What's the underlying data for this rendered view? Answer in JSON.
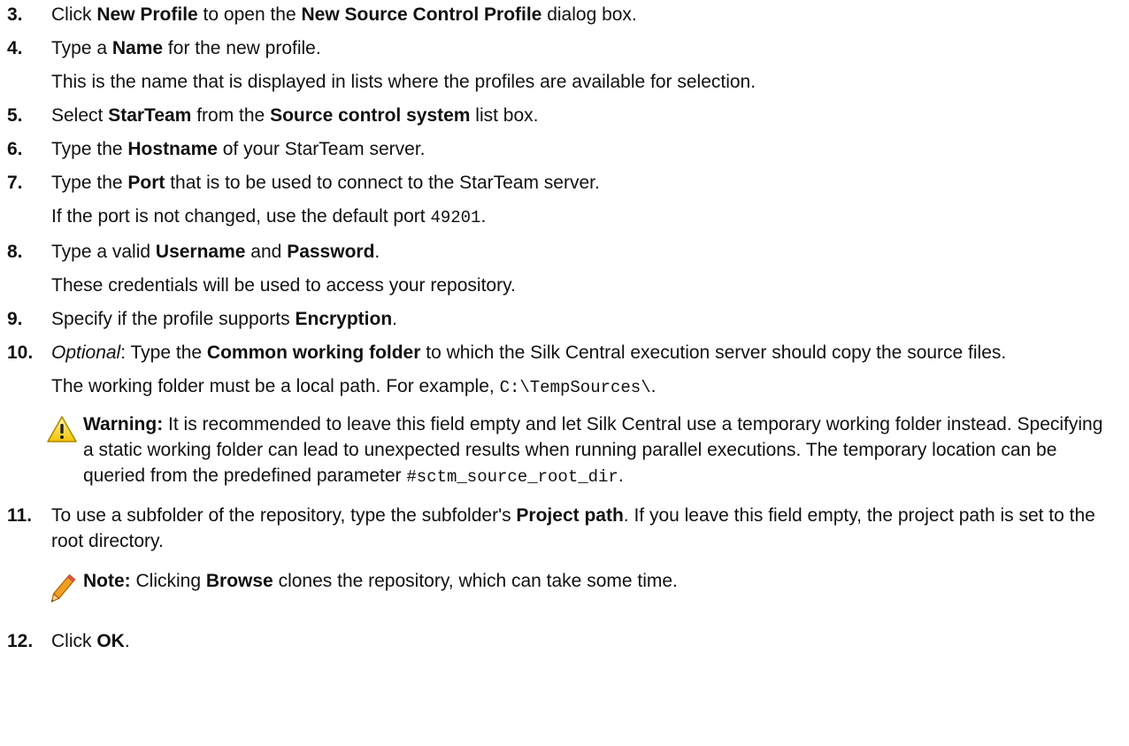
{
  "steps": [
    {
      "num": "3.",
      "parts": [
        "Click ",
        "New Profile",
        " to open the ",
        "New Source Control Profile",
        " dialog box."
      ]
    },
    {
      "num": "4.",
      "parts": [
        "Type a ",
        "Name",
        " for the new profile."
      ],
      "note": "This is the name that is displayed in lists where the profiles are available for selection."
    },
    {
      "num": "5.",
      "parts": [
        "Select ",
        "StarTeam",
        " from the ",
        "Source control system",
        " list box."
      ]
    },
    {
      "num": "6.",
      "parts": [
        "Type the ",
        "Hostname",
        " of your StarTeam server."
      ]
    },
    {
      "num": "7.",
      "parts": [
        "Type the ",
        "Port",
        " that is to be used to connect to the StarTeam server."
      ],
      "note_parts": [
        "If the port is not changed, use the default port ",
        "49201",
        "."
      ]
    },
    {
      "num": "8.",
      "parts": [
        "Type a valid ",
        "Username",
        " and ",
        "Password",
        "."
      ],
      "note": "These credentials will be used to access your repository."
    },
    {
      "num": "9.",
      "parts": [
        "Specify if the profile supports ",
        "Encryption",
        "."
      ]
    },
    {
      "num": "10.",
      "parts": [
        "Optional",
        ": Type the ",
        "Common working folder",
        " to which the Silk Central execution server should copy the source files."
      ],
      "note_parts": [
        "The working folder must be a local path. For example, ",
        "C:\\TempSources\\",
        "."
      ]
    },
    {
      "num": "11.",
      "parts": [
        "To use a subfolder of the repository, type the subfolder's ",
        "Project path",
        ". If you leave this field empty, the project path is set to the root directory."
      ]
    },
    {
      "num": "12.",
      "parts": [
        "Click ",
        "OK",
        "."
      ]
    }
  ],
  "warning": {
    "icon": "warning-triangle-icon",
    "label": "Warning:",
    "text": " It is recommended to leave this field empty and let Silk Central use a temporary working folder instead. Specifying a static working folder can lead to unexpected results when running parallel executions. The temporary location can be queried from the predefined parameter ",
    "code": "#sctm_source_root_dir",
    "end": "."
  },
  "note": {
    "icon": "pencil-note-icon",
    "label": "Note:",
    "pre": " Clicking ",
    "bold": "Browse",
    "post": " clones the repository, which can take some time."
  }
}
